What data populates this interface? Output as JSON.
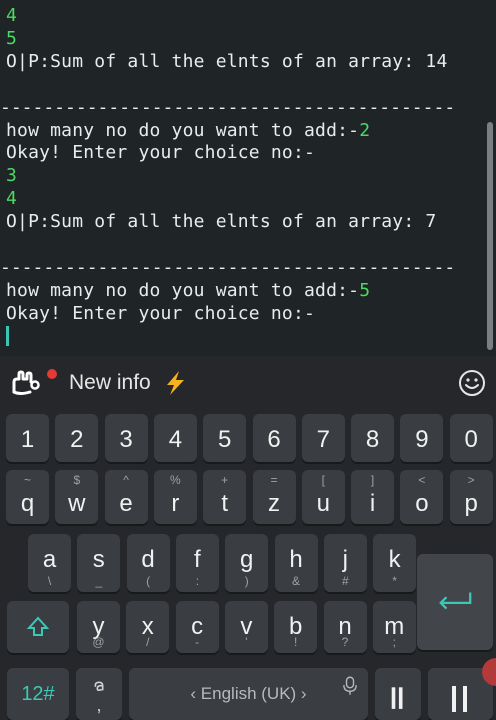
{
  "terminal": {
    "lines": [
      {
        "kind": "num",
        "text": "4"
      },
      {
        "kind": "num",
        "text": "5"
      },
      {
        "kind": "text",
        "text": "O|P:Sum of all the elnts of an array: 14"
      },
      {
        "kind": "blank",
        "text": ""
      },
      {
        "kind": "sep",
        "text": "------------------------------------------"
      },
      {
        "kind": "prompt",
        "text": "how many no do you want to add:-",
        "input": "2"
      },
      {
        "kind": "text",
        "text": "Okay! Enter your choice no:-"
      },
      {
        "kind": "num",
        "text": "3"
      },
      {
        "kind": "num",
        "text": "4"
      },
      {
        "kind": "text",
        "text": "O|P:Sum of all the elnts of an array: 7"
      },
      {
        "kind": "blank",
        "text": ""
      },
      {
        "kind": "sep",
        "text": "------------------------------------------"
      },
      {
        "kind": "prompt",
        "text": "how many no do you want to add:-",
        "input": "5"
      },
      {
        "kind": "text",
        "text": "Okay! Enter your choice no:-"
      }
    ]
  },
  "keyboard": {
    "toolbar": {
      "news_label": "New info",
      "icons": [
        "keyboard-logo-icon",
        "notification-dot-icon",
        "lightning-bolt-icon",
        "emoji-icon"
      ]
    },
    "number_row": [
      "1",
      "2",
      "3",
      "4",
      "5",
      "6",
      "7",
      "8",
      "9",
      "0"
    ],
    "row1": [
      {
        "main": "q",
        "sub": "~"
      },
      {
        "main": "w",
        "sub": "$"
      },
      {
        "main": "e",
        "sub": "^"
      },
      {
        "main": "r",
        "sub": "%"
      },
      {
        "main": "t",
        "sub": "+"
      },
      {
        "main": "z",
        "sub": "="
      },
      {
        "main": "u",
        "sub": "["
      },
      {
        "main": "i",
        "sub": "]"
      },
      {
        "main": "o",
        "sub": "<"
      },
      {
        "main": "p",
        "sub": ">"
      }
    ],
    "row2": [
      {
        "main": "a",
        "sub": "\\"
      },
      {
        "main": "s",
        "sub": "_"
      },
      {
        "main": "d",
        "sub": "("
      },
      {
        "main": "f",
        "sub": ":"
      },
      {
        "main": "g",
        "sub": ")"
      },
      {
        "main": "h",
        "sub": "&"
      },
      {
        "main": "j",
        "sub": "#"
      },
      {
        "main": "k",
        "sub": "*"
      }
    ],
    "row3": [
      {
        "main": "y",
        "sub": "@"
      },
      {
        "main": "x",
        "sub": "/"
      },
      {
        "main": "c",
        "sub": "-"
      },
      {
        "main": "v",
        "sub": "'"
      },
      {
        "main": "b",
        "sub": "!"
      },
      {
        "main": "n",
        "sub": "?"
      },
      {
        "main": "m",
        "sub": ";"
      }
    ],
    "bottom": {
      "symbols_label": "12#",
      "space_label": "‹  English (UK)  ›",
      "comma_label": ","
    },
    "colors": {
      "accent": "#3cc8b6",
      "key": "#3a3d42",
      "background": "#25272b",
      "terminal_input": "#4cd964"
    }
  }
}
